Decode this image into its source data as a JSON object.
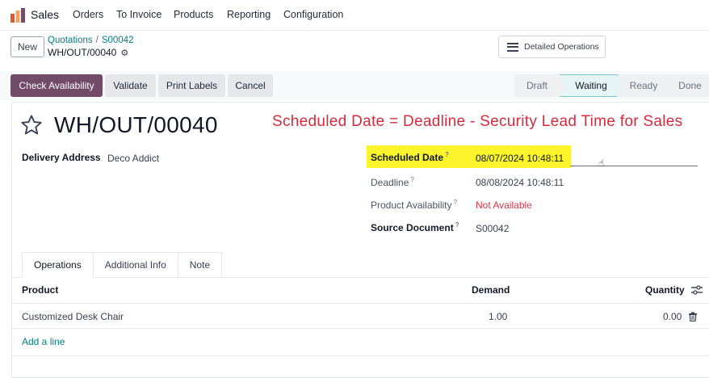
{
  "navbar": {
    "app_name": "Sales",
    "items": [
      "Orders",
      "To Invoice",
      "Products",
      "Reporting",
      "Configuration"
    ]
  },
  "control_panel": {
    "new_label": "New",
    "breadcrumb": [
      "Quotations",
      "S00042"
    ],
    "breadcrumb_sep": "/",
    "record_name": "WH/OUT/00040",
    "detailed_operations_label": "Detailed Operations"
  },
  "actions": {
    "check_availability": "Check Availability",
    "validate": "Validate",
    "print_labels": "Print Labels",
    "cancel": "Cancel"
  },
  "statusbar": {
    "stages": [
      "Draft",
      "Waiting",
      "Ready",
      "Done"
    ],
    "active": "Waiting"
  },
  "form": {
    "title": "WH/OUT/00040",
    "annotation": "Scheduled Date = Deadline - Security Lead Time for Sales",
    "delivery_address_label": "Delivery Address",
    "delivery_address_value": "Deco Addict",
    "scheduled_date_label": "Scheduled Date",
    "scheduled_date_value": "08/07/2024 10:48:11",
    "deadline_label": "Deadline",
    "deadline_value": "08/08/2024 10:48:11",
    "product_availability_label": "Product Availability",
    "product_availability_value": "Not Available",
    "source_document_label": "Source Document",
    "source_document_value": "S00042",
    "help_mark": "?"
  },
  "tabs": [
    "Operations",
    "Additional Info",
    "Note"
  ],
  "table": {
    "columns": [
      "Product",
      "Demand",
      "Quantity"
    ],
    "rows": [
      {
        "product": "Customized Desk Chair",
        "demand": "1.00",
        "quantity": "0.00"
      }
    ],
    "add_line": "Add a line"
  },
  "colors": {
    "primary": "#714b67",
    "link": "#017e84",
    "annotation": "#d62b3b",
    "highlight": "#fdf52c",
    "danger": "#dc3545"
  },
  "icons": [
    "app-logo-icon",
    "gear-icon",
    "hamburger-icon",
    "star-icon",
    "cursor-icon",
    "trash-icon",
    "column-settings-icon"
  ]
}
